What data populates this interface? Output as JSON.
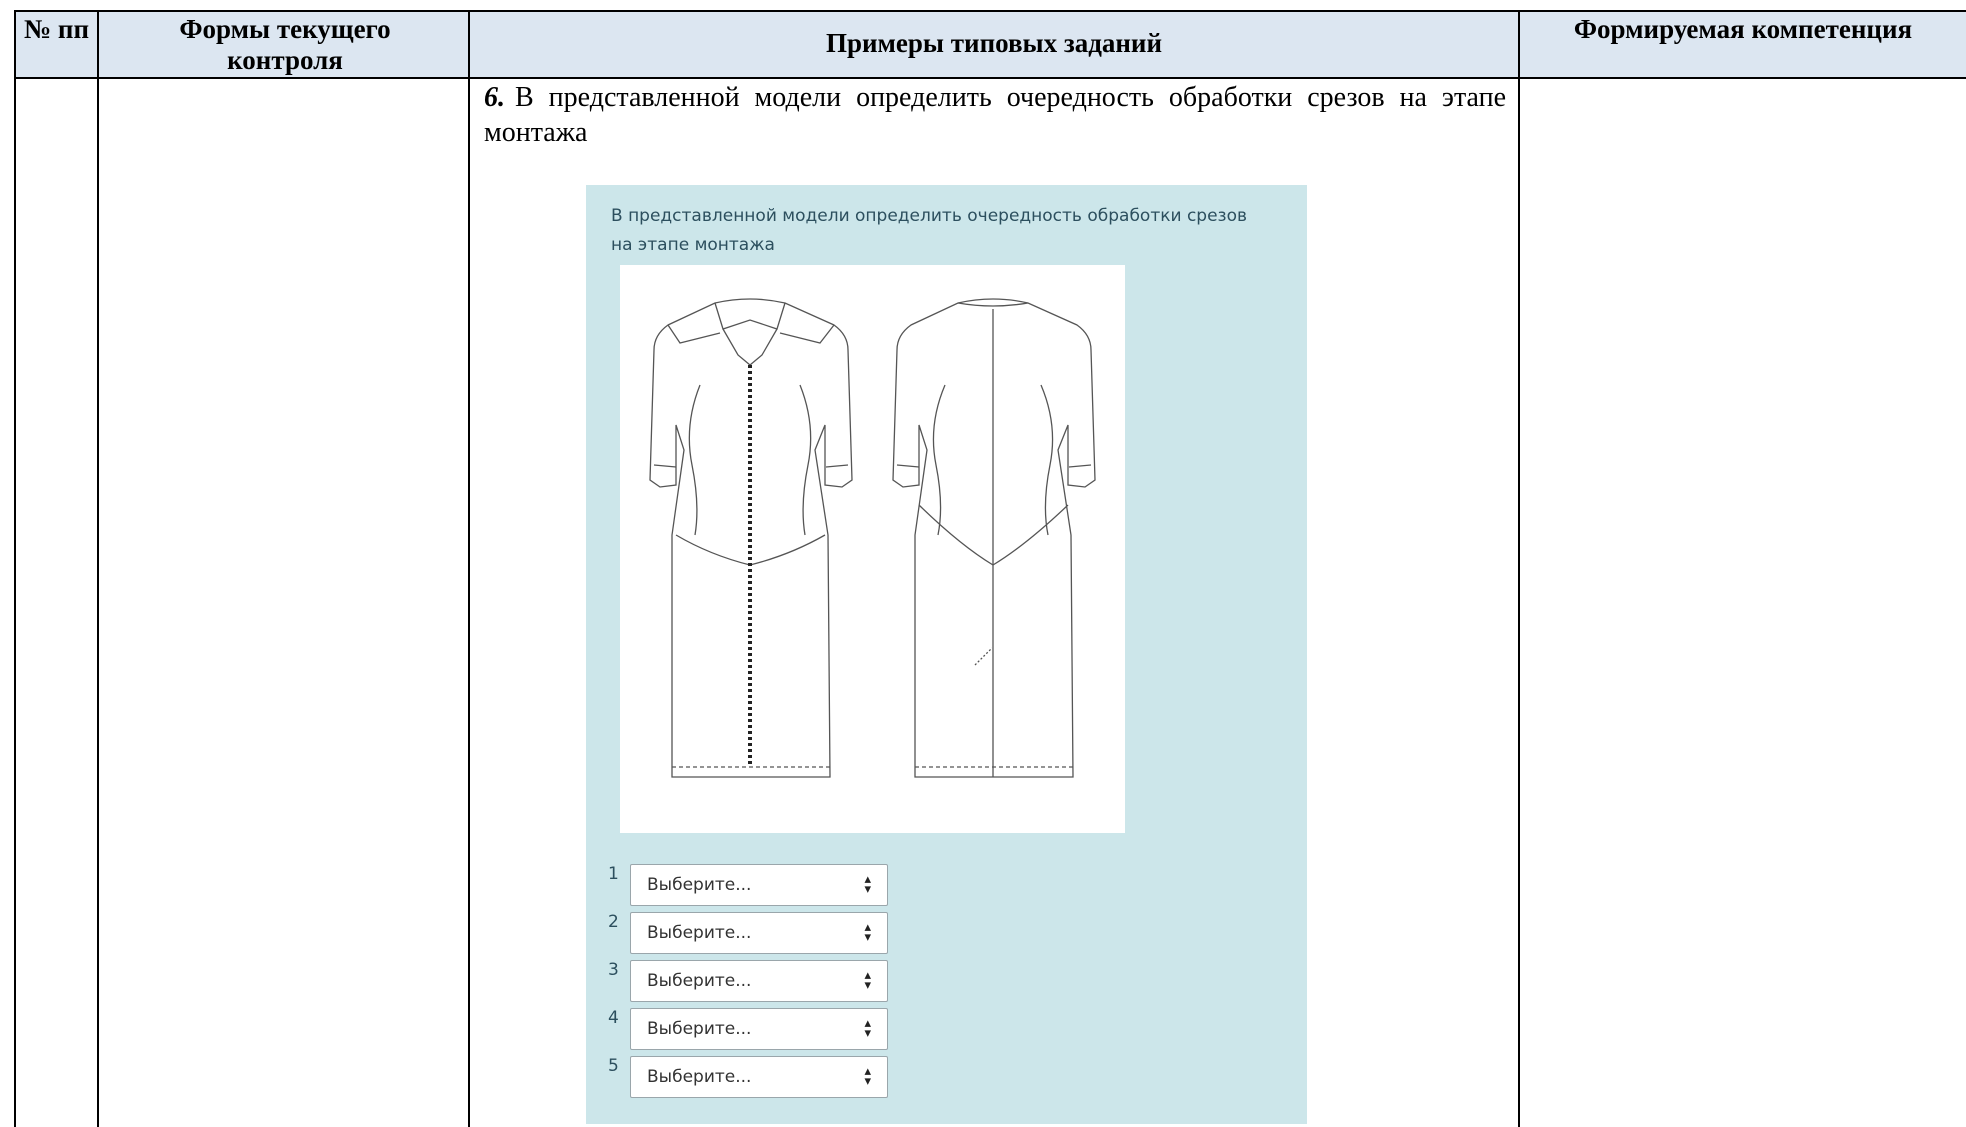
{
  "table": {
    "headers": {
      "num": "№ пп",
      "forms": "Формы текущего контроля",
      "examples": "Примеры типовых заданий",
      "competence": "Формируемая компетенция"
    }
  },
  "task": {
    "number": "6.",
    "text": "В представленной модели определить очередность обработки срезов на этапе монтажа"
  },
  "quiz": {
    "question": "В представленной модели определить очередность обработки срезов на этапе монтажа",
    "image_description": "technical drawing of a dress, front and back views",
    "selects": [
      {
        "index": "1",
        "value": "Выберите..."
      },
      {
        "index": "2",
        "value": "Выберите..."
      },
      {
        "index": "3",
        "value": "Выберите..."
      },
      {
        "index": "4",
        "value": "Выберите..."
      },
      {
        "index": "5",
        "value": "Выберите..."
      }
    ],
    "panel_color": "#cce6ea"
  }
}
